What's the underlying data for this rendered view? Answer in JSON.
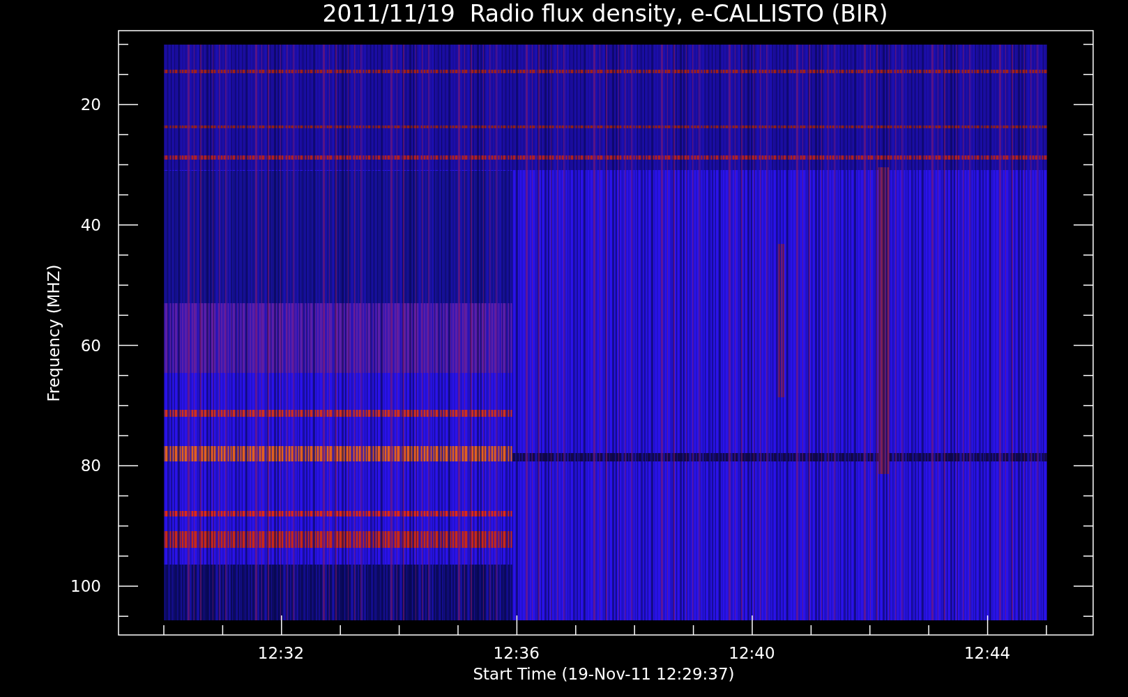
{
  "title": "2011/11/19  Radio flux density, e-CALLISTO (BIR)",
  "y_axis": {
    "label": "Frequency (MHZ)",
    "ticks": [
      "20",
      "40",
      "60",
      "80",
      "100"
    ]
  },
  "x_axis": {
    "label": "Start Time (19-Nov-11 12:29:37)",
    "ticks": [
      "12:32",
      "12:36",
      "12:40",
      "12:44"
    ]
  }
}
